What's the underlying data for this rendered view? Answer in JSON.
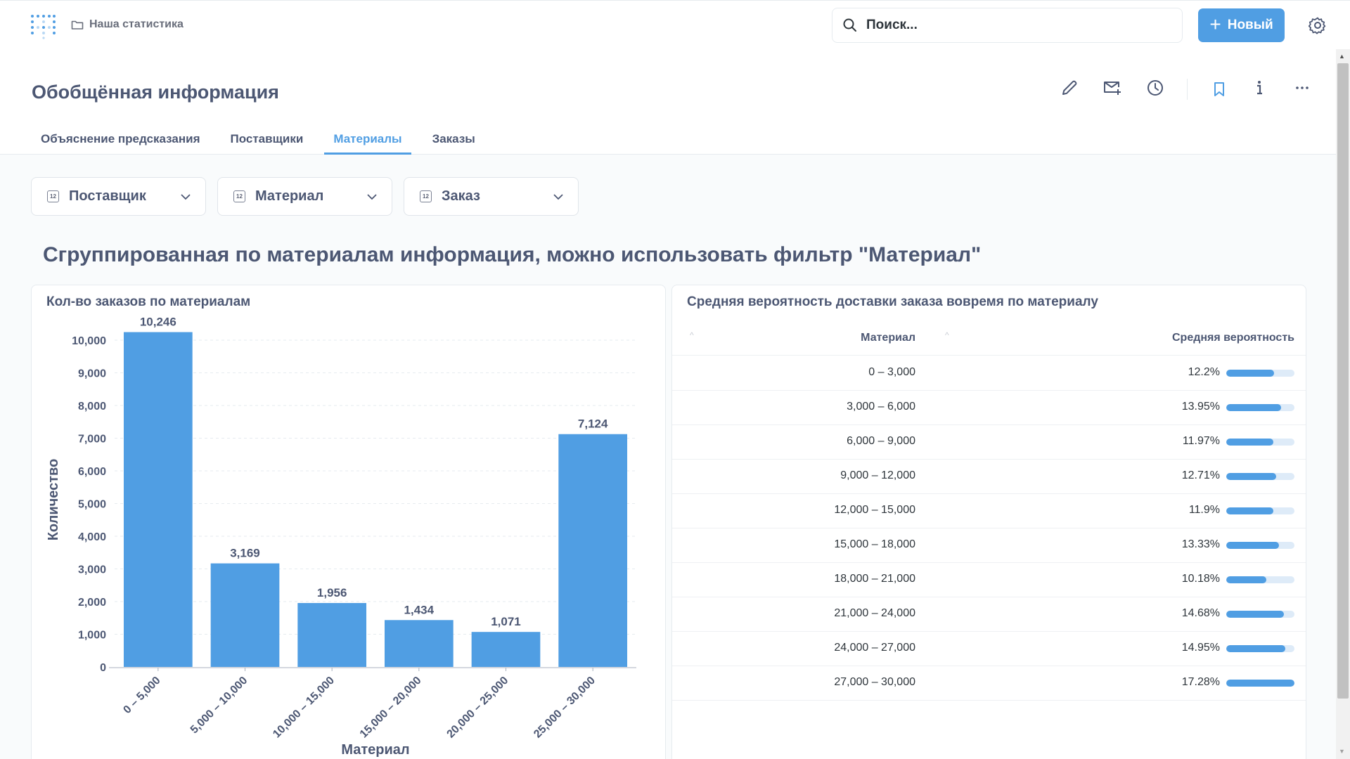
{
  "app": {
    "breadcrumb": "Наша статистика",
    "search_placeholder": "Поиск...",
    "new_button": "Новый"
  },
  "page": {
    "title": "Обобщённая информация",
    "tabs": [
      {
        "label": "Объяснение предсказания",
        "active": false
      },
      {
        "label": "Поставщики",
        "active": false
      },
      {
        "label": "Материалы",
        "active": true
      },
      {
        "label": "Заказы",
        "active": false
      }
    ]
  },
  "filters": [
    {
      "label": "Поставщик"
    },
    {
      "label": "Материал"
    },
    {
      "label": "Заказ"
    }
  ],
  "section_title": "Сгруппированная по материалам информация, можно использовать фильтр \"Материал\"",
  "bar_card": {
    "title": "Кол-во заказов по материалам"
  },
  "chart_data": {
    "type": "bar",
    "title": "Кол-во заказов по материалам",
    "xlabel": "Материал",
    "ylabel": "Количество",
    "categories": [
      "0 – 5,000",
      "5,000 – 10,000",
      "10,000 – 15,000",
      "15,000 – 20,000",
      "20,000 – 25,000",
      "25,000 – 30,000"
    ],
    "values": [
      10246,
      3169,
      1956,
      1434,
      1071,
      7124
    ],
    "value_labels": [
      "10,246",
      "3,169",
      "1,956",
      "1,434",
      "1,071",
      "7,124"
    ],
    "yticks": [
      "0",
      "1,000",
      "2,000",
      "3,000",
      "4,000",
      "5,000",
      "6,000",
      "7,000",
      "8,000",
      "9,000",
      "10,000"
    ],
    "ylim": [
      0,
      10000
    ],
    "grid": true,
    "color": "#509ee3"
  },
  "table_card": {
    "title": "Средняя вероятность доставки заказа вовремя по материалу",
    "columns": [
      "Материал",
      "Средняя вероятность"
    ],
    "rows": [
      {
        "material": "0 – 3,000",
        "pct": "12.2%",
        "value": 12.2
      },
      {
        "material": "3,000 – 6,000",
        "pct": "13.95%",
        "value": 13.95
      },
      {
        "material": "6,000 – 9,000",
        "pct": "11.97%",
        "value": 11.97
      },
      {
        "material": "9,000 – 12,000",
        "pct": "12.71%",
        "value": 12.71
      },
      {
        "material": "12,000 – 15,000",
        "pct": "11.9%",
        "value": 11.9
      },
      {
        "material": "15,000 – 18,000",
        "pct": "13.33%",
        "value": 13.33
      },
      {
        "material": "18,000 – 21,000",
        "pct": "10.18%",
        "value": 10.18
      },
      {
        "material": "21,000 – 24,000",
        "pct": "14.68%",
        "value": 14.68
      },
      {
        "material": "24,000 – 27,000",
        "pct": "14.95%",
        "value": 14.95
      },
      {
        "material": "27,000 – 30,000",
        "pct": "17.28%",
        "value": 17.28
      }
    ]
  },
  "colors": {
    "accent": "#509ee3",
    "text": "#4c5773",
    "bar_track": "#deebf8"
  }
}
